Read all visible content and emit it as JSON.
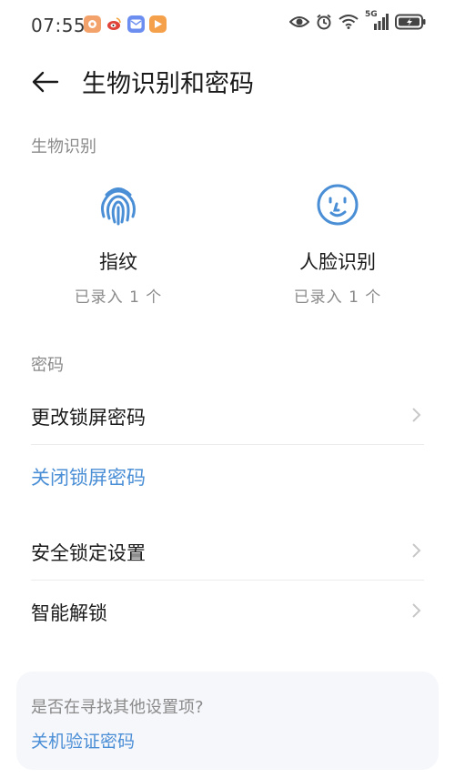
{
  "status": {
    "time": "07:55",
    "network": "5G"
  },
  "header": {
    "title": "生物识别和密码"
  },
  "biometrics": {
    "section_label": "生物识别",
    "fingerprint": {
      "name": "指纹",
      "status": "已录入 1 个"
    },
    "face": {
      "name": "人脸识别",
      "status": "已录入 1 个"
    }
  },
  "password": {
    "section_label": "密码",
    "change_lock": "更改锁屏密码",
    "disable_lock": "关闭锁屏密码",
    "security_lock": "安全锁定设置",
    "smart_unlock": "智能解锁"
  },
  "suggestion": {
    "question": "是否在寻找其他设置项?",
    "link": "关机验证密码"
  },
  "colors": {
    "accent": "#4a8ed6",
    "secondary_text": "#8a8a8a",
    "card_bg": "#f6f7fb"
  }
}
